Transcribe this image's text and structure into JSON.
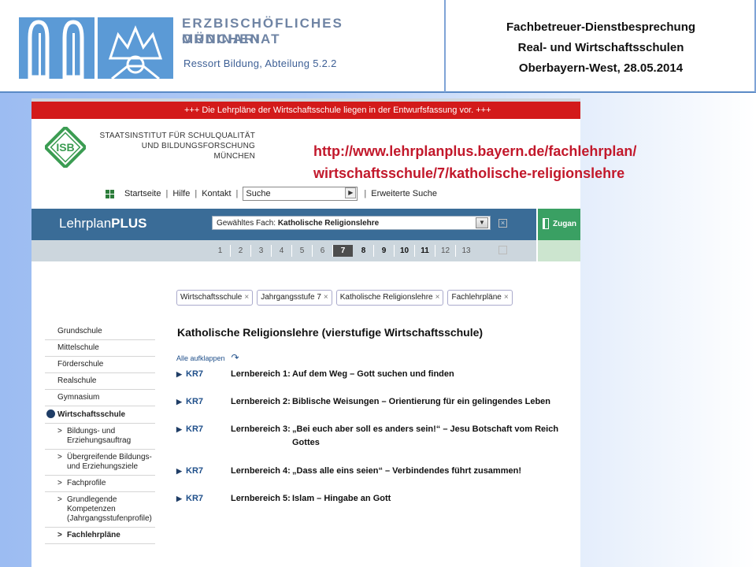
{
  "slide": {
    "org_line1": "ERZBISCHÖFLICHES ORDINARIAT",
    "org_line2": "MÜNCHEN",
    "org_sub": "Ressort Bildung, Abteilung 5.2.2",
    "meeting_line1": "Fachbetreuer-Dienstbesprechung",
    "meeting_line2": "Real- und Wirtschaftsschulen",
    "meeting_line3": "Oberbayern-West, 28.05.2014",
    "url_line1": "http://www.lehrplanplus.bayern.de/fachlehrplan/",
    "url_line2": "wirtschaftsschule/7/katholische-religionslehre",
    "colors": {
      "url": "#c2182b",
      "header_border": "#5a8ac6"
    }
  },
  "site": {
    "announcement": "+++ Die Lehrpläne der Wirtschaftsschule liegen in der Entwurfsfassung vor. +++",
    "isb_logo_text": "ISB",
    "institute_line1": "STAATSINSTITUT FÜR SCHULQUALITÄT",
    "institute_line2": "UND BILDUNGSFORSCHUNG",
    "institute_line3": "MÜNCHEN",
    "nav": {
      "start": "Startseite",
      "help": "Hilfe",
      "contact": "Kontakt",
      "search_value": "Suche",
      "advanced": "Erweiterte Suche",
      "separator": "|"
    },
    "lp_title_light": "Lehrplan",
    "lp_title_bold": "PLUS",
    "subject_prefix": "Gewähltes Fach:",
    "subject_value": "Katholische Religionslehre",
    "access_label": "Zugan",
    "grades": [
      "1",
      "2",
      "3",
      "4",
      "5",
      "6",
      "7",
      "8",
      "9",
      "10",
      "11",
      "12",
      "13"
    ],
    "selected_grade": "7",
    "filters": [
      "Wirtschaftsschule",
      "Jahrgangsstufe 7",
      "Katholische Religionslehre",
      "Fachlehrpläne"
    ],
    "sidebar": {
      "school_types": [
        "Grundschule",
        "Mittelschule",
        "Förderschule",
        "Realschule",
        "Gymnasium"
      ],
      "active": "Wirtschaftsschule",
      "sub_items": [
        "Bildungs- und Erziehungsauftrag",
        "Übergreifende Bildungs- und Erziehungsziele",
        "Fachprofile",
        "Grundlegende Kompetenzen (Jahrgangsstufenprofile)",
        "Fachlehrpläne"
      ]
    },
    "content_title": "Katholische Religionslehre (vierstufige Wirtschaftsschule)",
    "expand_all": "Alle aufklappen",
    "lernbereiche": [
      {
        "code": "KR7",
        "label": "Lernbereich 1:",
        "name": "Auf dem Weg – Gott suchen und finden"
      },
      {
        "code": "KR7",
        "label": "Lernbereich 2:",
        "name": "Biblische Weisungen – Orientierung für ein gelingendes Leben"
      },
      {
        "code": "KR7",
        "label": "Lernbereich 3:",
        "name": "„Bei euch aber soll es anders sein!“ – Jesu Botschaft vom Reich Gottes"
      },
      {
        "code": "KR7",
        "label": "Lernbereich 4:",
        "name": "„Dass alle eins seien“ – Verbindendes führt zusammen!"
      },
      {
        "code": "KR7",
        "label": "Lernbereich 5:",
        "name": "Islam – Hingabe an Gott"
      }
    ],
    "colors": {
      "announce": "#d31a1a",
      "lp_bar": "#3a6c97",
      "access": "#3aa063",
      "grade_bar": "#ccd6dd"
    }
  }
}
